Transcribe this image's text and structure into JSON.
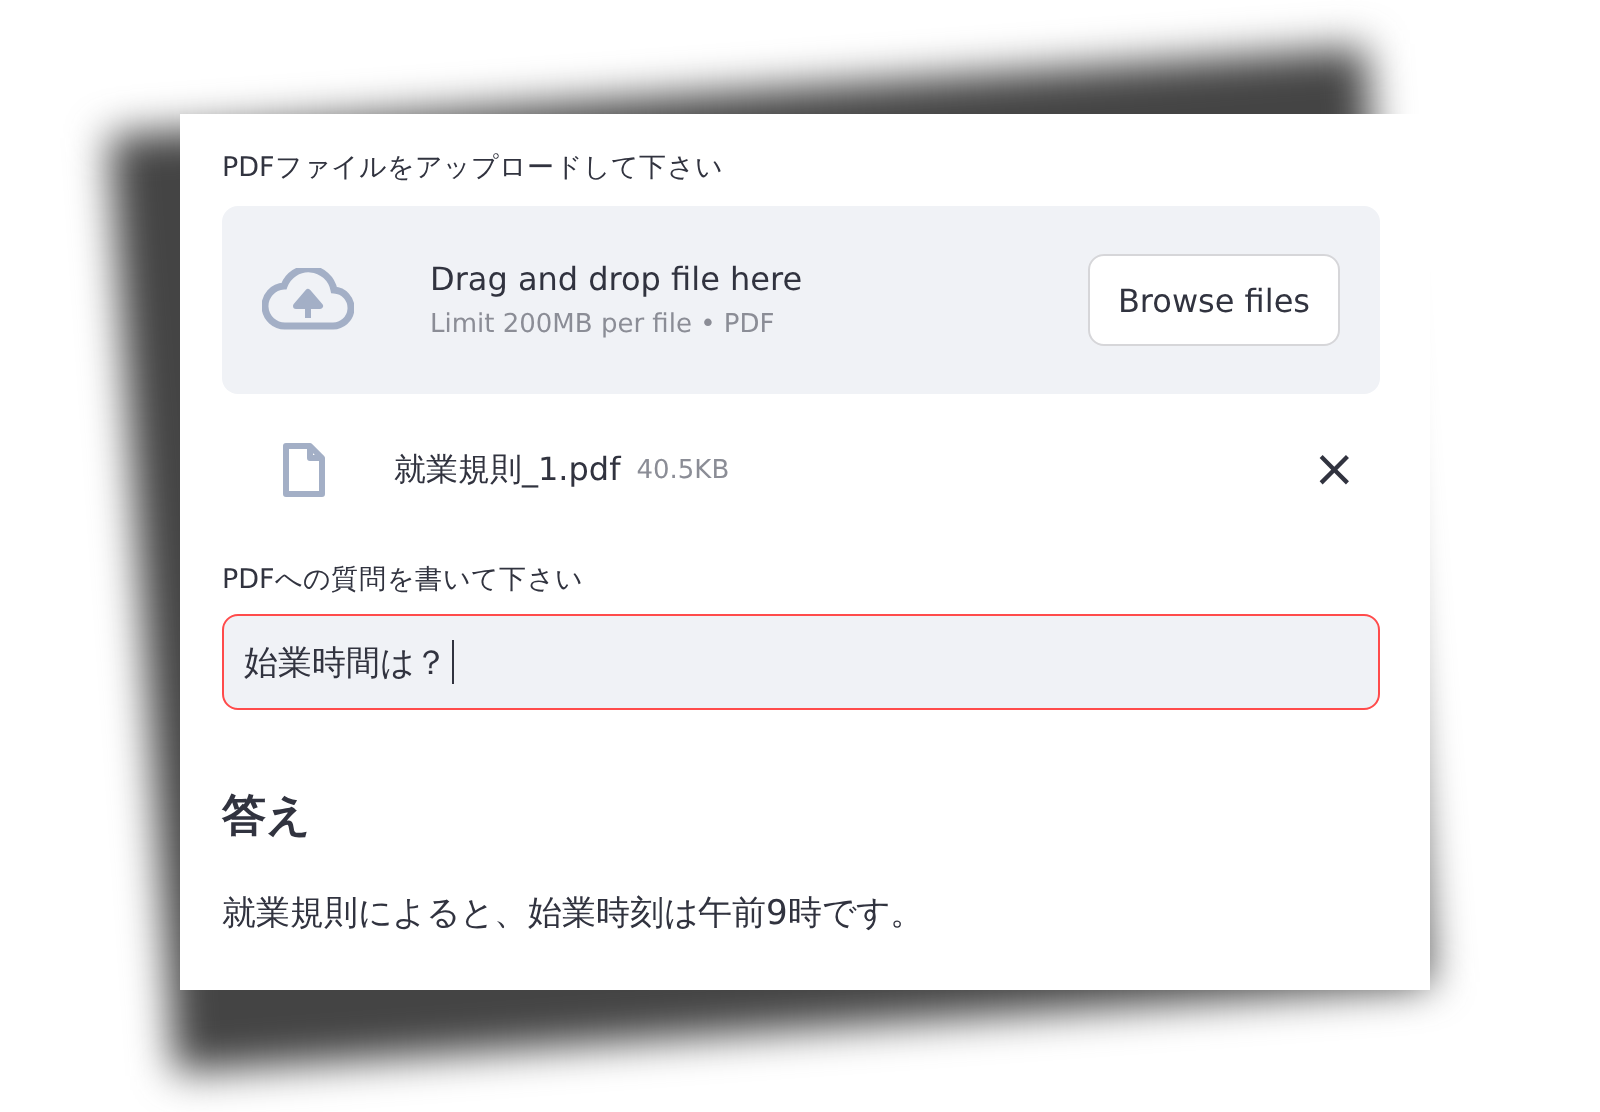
{
  "uploader": {
    "label": "PDFファイルをアップロードして下さい",
    "title": "Drag and drop file here",
    "limit": "Limit 200MB per file • PDF",
    "button": "Browse files"
  },
  "uploaded_file": {
    "name": "就業規則_1.pdf",
    "size": "40.5KB",
    "remove": "×"
  },
  "question": {
    "label": "PDFへの質問を書いて下さい",
    "value": "始業時間は？",
    "focused": true
  },
  "answer": {
    "heading": "答え",
    "text": "就業規則によると、始業時刻は午前9時です。"
  }
}
